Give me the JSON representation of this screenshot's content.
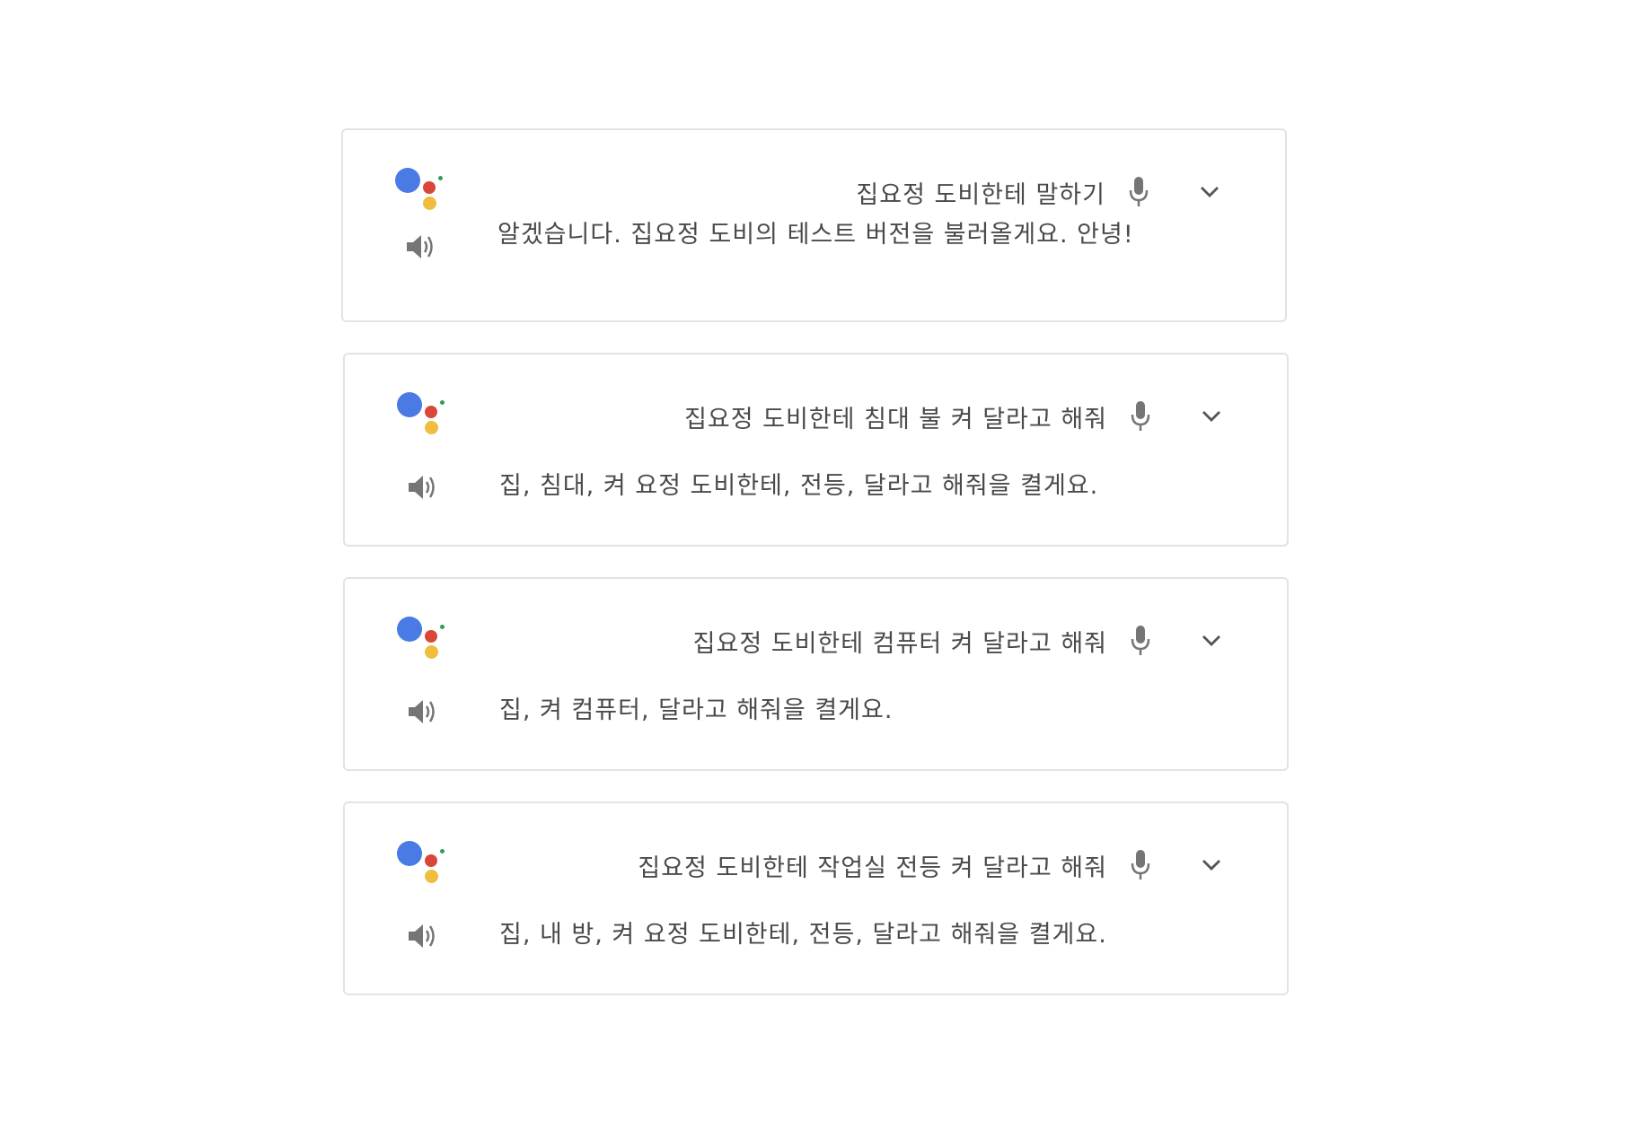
{
  "cards": [
    {
      "query": "집요정 도비한테 말하기",
      "response": "알겠습니다. 집요정 도비의 테스트 버전을 불러올게요. 안녕!"
    },
    {
      "query": "집요정 도비한테 침대 불 켜 달라고 해줘",
      "response": "집, 침대, 켜 요정 도비한테, 전등, 달라고 해줘을 켤게요."
    },
    {
      "query": "집요정 도비한테 컴퓨터 켜 달라고 해줘",
      "response": "집, 켜 컴퓨터, 달라고 해줘을 켤게요."
    },
    {
      "query": "집요정 도비한테 작업실 전등 켜 달라고 해줘",
      "response": "집, 내 방, 켜 요정 도비한테, 전등, 달라고 해줘을 켤게요."
    }
  ],
  "icons": {
    "logo": "google-assistant-logo",
    "mic": "microphone-icon",
    "chevron": "chevron-down-icon",
    "speaker": "speaker-icon"
  },
  "colors": {
    "logo_blue": "#4a7be4",
    "logo_red": "#d9473b",
    "logo_yellow": "#f1bd3e",
    "logo_green": "#2f9e58",
    "text": "#4a4a4a",
    "icon": "#757575",
    "border": "#e3e3e3"
  }
}
